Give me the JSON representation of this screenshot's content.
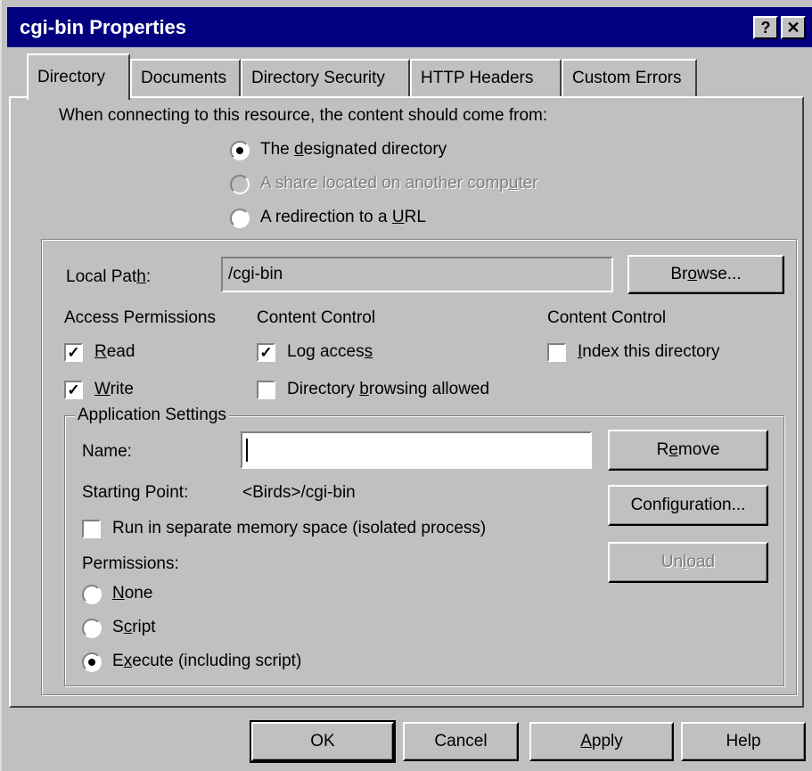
{
  "window": {
    "title": "cgi-bin Properties",
    "help_button": "?",
    "close_button": "✕"
  },
  "tabs": [
    "Directory",
    "Documents",
    "Directory Security",
    "HTTP Headers",
    "Custom Errors"
  ],
  "source": {
    "prompt": "When connecting to this resource, the content should come from:",
    "options": [
      {
        "pre": "The ",
        "key": "d",
        "post": "esignated directory",
        "selected": true,
        "enabled": true
      },
      {
        "pre": "A share located on another comp",
        "key": "u",
        "post": "ter",
        "selected": false,
        "enabled": false
      },
      {
        "pre": "A redirection to a ",
        "key": "U",
        "post": "RL",
        "selected": false,
        "enabled": true
      }
    ]
  },
  "local_path": {
    "label_pre": "Local Pat",
    "label_key": "h",
    "label_post": ":",
    "value": "/cgi-bin",
    "browse_pre": "Br",
    "browse_key": "o",
    "browse_post": "wse..."
  },
  "access_permissions": {
    "heading": "Access Permissions",
    "read": {
      "key": "R",
      "post": "ead",
      "checked": true
    },
    "write": {
      "key": "W",
      "post": "rite",
      "checked": true
    }
  },
  "content_control_1": {
    "heading": "Content Control",
    "log_access": {
      "pre": "Log acces",
      "key": "s",
      "post": "",
      "checked": true
    },
    "dir_browsing": {
      "pre": "Directory ",
      "key": "b",
      "post": "rowsing allowed",
      "checked": false
    }
  },
  "content_control_2": {
    "heading": "Content Control",
    "index": {
      "pre": "",
      "key": "I",
      "post": "ndex this directory",
      "checked": false
    }
  },
  "app_settings": {
    "heading": "Application Settings",
    "name_label": "Name:",
    "name_value": "",
    "starting_point_label": "Starting Point:",
    "starting_point_value": "<Birds>/cgi-bin",
    "isolated": {
      "pre": "Run in separate memory space (isolated process)",
      "checked": false
    },
    "permissions_label": "Permissions:",
    "permissions": [
      {
        "pre": "",
        "key": "N",
        "post": "one",
        "selected": false
      },
      {
        "pre": "S",
        "key": "c",
        "post": "ript",
        "selected": false
      },
      {
        "pre": "E",
        "key": "x",
        "post": "ecute (including script)",
        "selected": true
      }
    ],
    "remove_pre": "R",
    "remove_key": "e",
    "remove_post": "move",
    "configuration": "Configuration...",
    "unload_pre": "Un",
    "unload_key": "l",
    "unload_post": "oad"
  },
  "footer": {
    "ok": "OK",
    "cancel": "Cancel",
    "apply_pre": "",
    "apply_key": "A",
    "apply_post": "pply",
    "help": "Help"
  }
}
